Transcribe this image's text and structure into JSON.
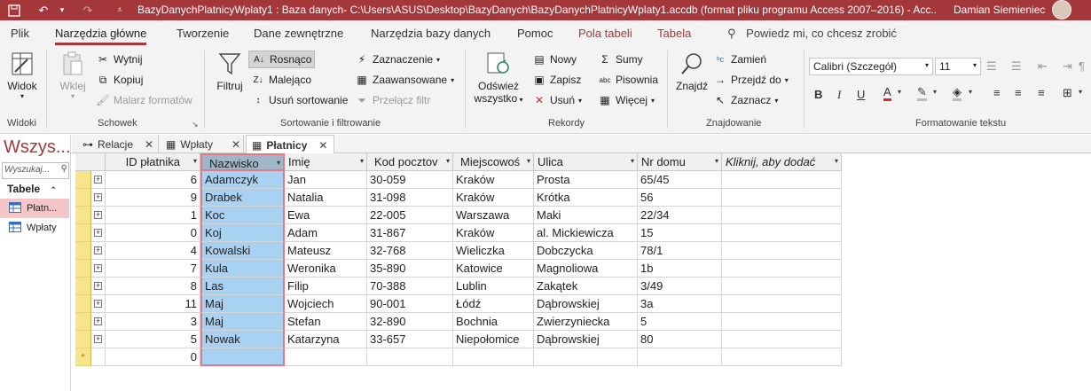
{
  "titlebar": {
    "title": "BazyDanychPlatnicyWplaty1 : Baza danych- C:\\Users\\ASUS\\Desktop\\BazyDanych\\BazyDanychPlatnicyWplaty1.accdb (format pliku programu Access 2007–2016)  -  Acc...",
    "user": "Damian Siemieniec"
  },
  "ribbon_tabs": [
    "Plik",
    "Narzędzia główne",
    "Tworzenie",
    "Dane zewnętrzne",
    "Narzędzia bazy danych",
    "Pomoc",
    "Pola tabeli",
    "Tabela"
  ],
  "tell_me": "Powiedz mi, co chcesz zrobić",
  "groups": {
    "widoki": {
      "label": "Widoki",
      "widok": "Widok"
    },
    "schowek": {
      "label": "Schowek",
      "wklej": "Wklej",
      "wytnij": "Wytnij",
      "kopiuj": "Kopiuj",
      "malarz": "Malarz formatów"
    },
    "sort": {
      "label": "Sortowanie i filtrowanie",
      "filtruj": "Filtruj",
      "rosnaco": "Rosnąco",
      "malejaco": "Malejąco",
      "usun_sort": "Usuń sortowanie",
      "zaznaczenie": "Zaznaczenie",
      "zaawansowane": "Zaawansowane",
      "przelacz": "Przełącz filtr"
    },
    "rekordy": {
      "label": "Rekordy",
      "odswiez": "Odśwież",
      "wszystko": "wszystko",
      "nowy": "Nowy",
      "zapisz": "Zapisz",
      "usun": "Usuń",
      "sumy": "Sumy",
      "pisownia": "Pisownia",
      "wiecej": "Więcej"
    },
    "znajdowanie": {
      "label": "Znajdowanie",
      "znajdz": "Znajdź",
      "zamien": "Zamień",
      "przejdz": "Przejdź do",
      "zaznacz": "Zaznacz"
    },
    "format": {
      "label": "Formatowanie tekstu",
      "font": "Calibri (Szczegół)",
      "size": "11"
    }
  },
  "nav": {
    "header": "Wszys...",
    "search_placeholder": "Wyszukaj...",
    "section": "Tabele",
    "items": [
      {
        "label": "Płatn..."
      },
      {
        "label": "Wpłaty"
      }
    ]
  },
  "object_tabs": [
    "Relacje",
    "Wpłaty",
    "Płatnicy"
  ],
  "table": {
    "headers": [
      "ID płatnika",
      "Nazwisko",
      "Imię",
      "Kod pocztov",
      "Miejscowoś",
      "Ulica",
      "Nr domu",
      "Kliknij, aby dodać"
    ],
    "rows": [
      [
        "6",
        "Adamczyk",
        "Jan",
        "30-059",
        "Kraków",
        "Prosta",
        "65/45"
      ],
      [
        "9",
        "Drabek",
        "Natalia",
        "31-098",
        "Kraków",
        "Krótka",
        "56"
      ],
      [
        "1",
        "Koc",
        "Ewa",
        "22-005",
        "Warszawa",
        "Maki",
        "22/34"
      ],
      [
        "0",
        "Koj",
        "Adam",
        "31-867",
        "Kraków",
        "al. Mickiewicza",
        "15"
      ],
      [
        "4",
        "Kowalski",
        "Mateusz",
        "32-768",
        "Wieliczka",
        "Dobczycka",
        "78/1"
      ],
      [
        "7",
        "Kula",
        "Weronika",
        "35-890",
        "Katowice",
        "Magnoliowa",
        "1b"
      ],
      [
        "8",
        "Las",
        "Filip",
        "70-388",
        "Lublin",
        "Zakątek",
        "3/49"
      ],
      [
        "11",
        "Maj",
        "Wojciech",
        "90-001",
        "Łódź",
        "Dąbrowskiej",
        "3a"
      ],
      [
        "3",
        "Maj",
        "Stefan",
        "32-890",
        "Bochnia",
        "Zwierzyniecka",
        "5"
      ],
      [
        "5",
        "Nowak",
        "Katarzyna",
        "33-657",
        "Niepołomice",
        "Dąbrowskiej",
        "80"
      ]
    ],
    "new_row_id": "0"
  },
  "colors": {
    "accent": "#a4373a",
    "selected_column": "#a9d1f2",
    "row_selector": "#f6e58a"
  }
}
